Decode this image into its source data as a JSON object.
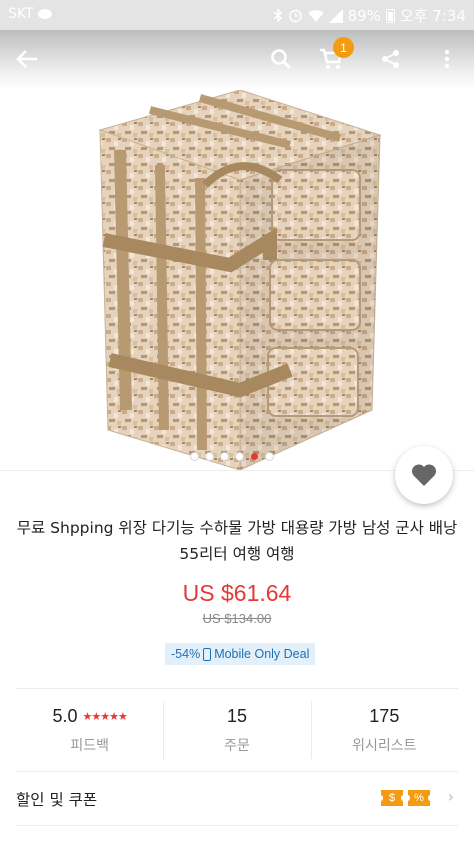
{
  "status_bar": {
    "carrier": "SKT",
    "battery": "89%",
    "time": "오후 7:34"
  },
  "app_bar": {
    "cart_count": "1",
    "icons": [
      "back-arrow-icon",
      "search-icon",
      "cart-icon",
      "share-icon",
      "more-vert-icon"
    ]
  },
  "gallery": {
    "image_count": 6,
    "active_index": 4
  },
  "product": {
    "title": "무료 Shpping 위장 다기능 수하물 가방 대용량 가방 남성 군사 배낭 55리터 여행 여행",
    "price": "US $61.64",
    "original_price": "US $134.00",
    "discount": "-54%",
    "deal_label": "Mobile Only Deal"
  },
  "stats": {
    "rating": {
      "value": "5.0",
      "stars": "★★★★★",
      "label": "피드백"
    },
    "orders": {
      "value": "15",
      "label": "주문"
    },
    "wishlist": {
      "value": "175",
      "label": "위시리스트"
    }
  },
  "coupon": {
    "label": "할인 및 쿠폰",
    "badge1": "$",
    "badge2": "%"
  },
  "colors": {
    "price_red": "#e53935",
    "accent_orange": "#f39c12",
    "deal_blue": "#1e6fb8"
  }
}
